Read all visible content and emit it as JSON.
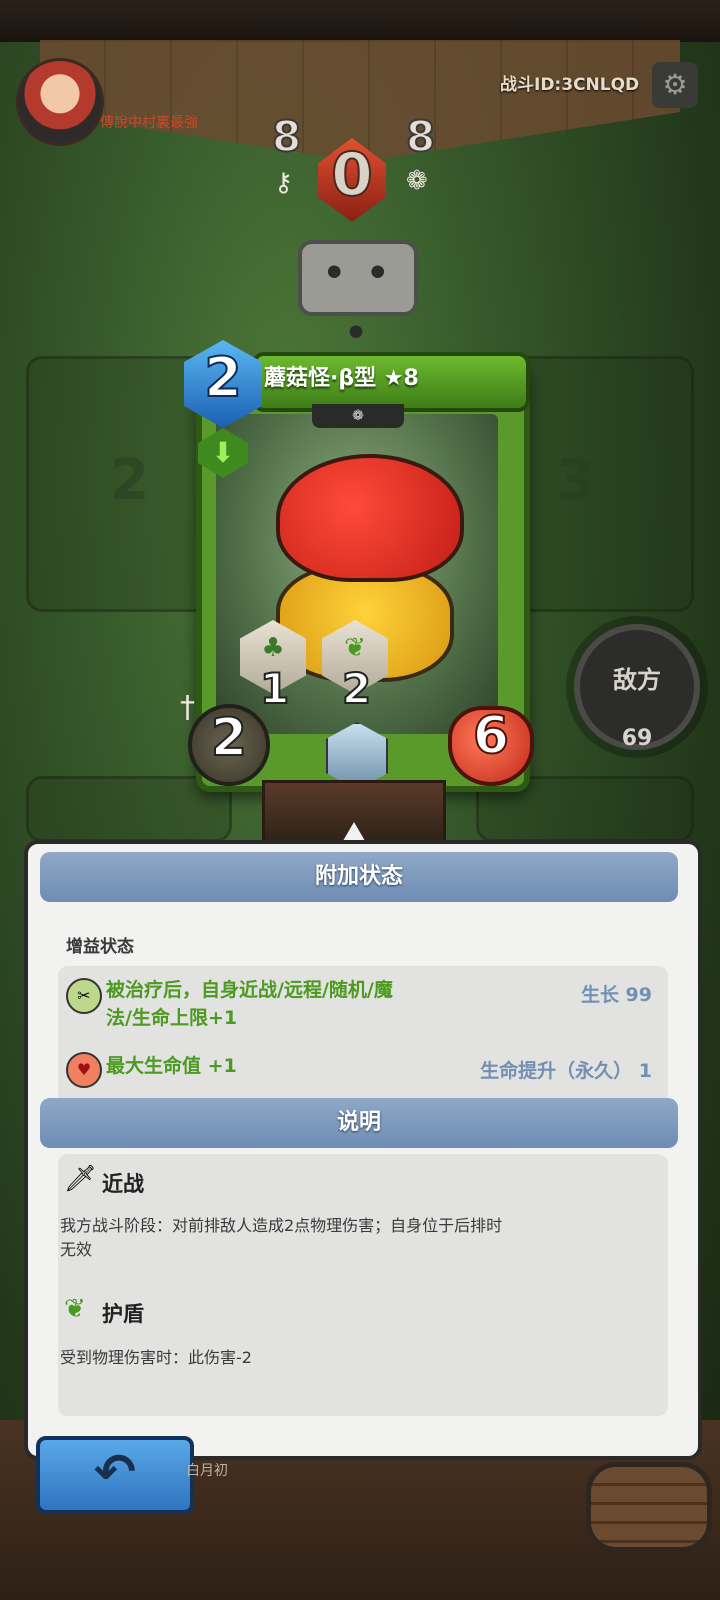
{
  "header": {
    "player_name": "傳說中村裏最強",
    "battle_id": "战斗ID:3CNLQD",
    "left_score": "8",
    "right_score": "8",
    "center_value": "0",
    "chat_bubble": "• • •"
  },
  "board": {
    "slot_left_number": "2",
    "slot_right_number": "3",
    "enemy_label": "敌方",
    "enemy_count": "69"
  },
  "card": {
    "title": "蘑菇怪·β型 ★8",
    "cost": "2",
    "attack": "2",
    "health": "6",
    "abilities": [
      {
        "icon": "sprout-icon",
        "count": "1"
      },
      {
        "icon": "leaf-shield-icon",
        "count": "2"
      }
    ]
  },
  "popup": {
    "title": "附加状态",
    "buff_section_label": "增益状态",
    "buffs": [
      {
        "text_line1": "被治疗后，自身近战/远程/随机/魔",
        "text_line2": "法/生命上限+1",
        "source": "生长 99",
        "icon": "wrench-icon"
      },
      {
        "text_line1": "最大生命值 +1",
        "text_line2": "",
        "source": "生命提升（永久） 1",
        "icon": "heart-icon"
      }
    ],
    "desc_title": "说明",
    "descriptions": [
      {
        "name": "近战",
        "icon": "sword-icon",
        "line1": "我方战斗阶段：对前排敌人造成2点物理伤害；自身位于后排时",
        "line2": "无效"
      },
      {
        "name": "护盾",
        "icon": "shield-leaf-icon",
        "line1": "受到物理伤害时：此伤害-2",
        "line2": ""
      }
    ]
  },
  "footer": {
    "back_icon": "↶",
    "opponent_name": "白月初"
  }
}
